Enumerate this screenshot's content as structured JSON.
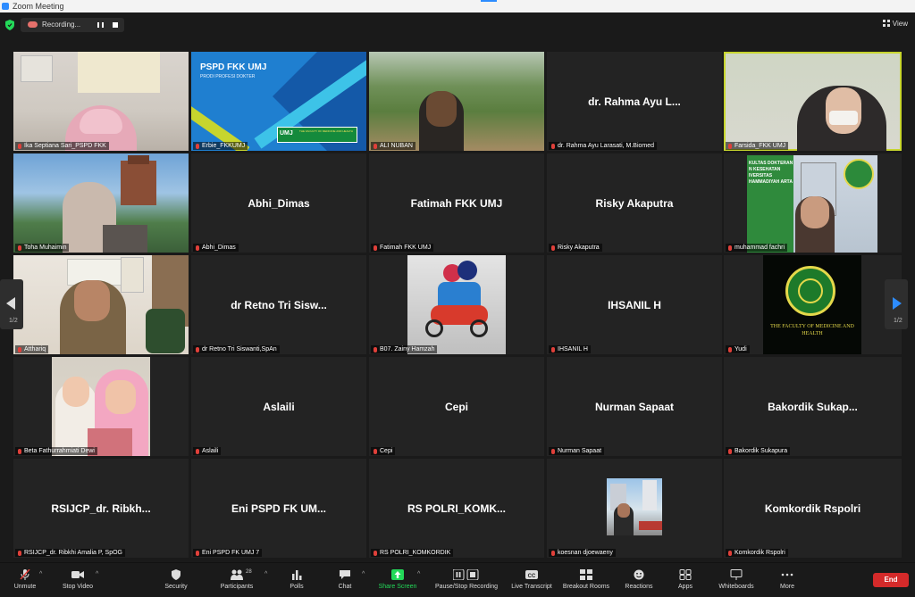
{
  "window": {
    "title": "Zoom Meeting"
  },
  "topbar": {
    "recording_label": "Recording...",
    "view_label": "View"
  },
  "pagination": {
    "left": "1/2",
    "right": "1/2"
  },
  "tiles": [
    {
      "label": "Ika Septiana Sari_PSPD FKK",
      "name": ""
    },
    {
      "label": "Erbie_FKKUMJ",
      "name": "",
      "slide_title": "PSPD FKK UMJ",
      "slide_sub": "PRODI PROFESI DOKTER",
      "slide_logo": "UMJ",
      "slide_badge": "THE FACULTY OF MEDICINE AND HEALTH"
    },
    {
      "label": "ALI NUBAN",
      "name": ""
    },
    {
      "label": "dr. Rahma Ayu Larasati, M.Biomed",
      "name": "dr. Rahma Ayu L..."
    },
    {
      "label": "Farsida_FKK UMJ",
      "name": ""
    },
    {
      "label": "Toha Muhaimin",
      "name": ""
    },
    {
      "label": "Abhi_Dimas",
      "name": "Abhi_Dimas"
    },
    {
      "label": "Fatimah FKK UMJ",
      "name": "Fatimah FKK UMJ"
    },
    {
      "label": "Risky Akaputra",
      "name": "Risky Akaputra"
    },
    {
      "label": "muhammad fachri",
      "name": "",
      "bg_text": "KULTAS DOKTERAN N KESEHATAN IVERSITAS HAMMADIYAH ARTA"
    },
    {
      "label": "Atthariq",
      "name": ""
    },
    {
      "label": "dr Retno Tri Siswanti,SpAn",
      "name": "dr Retno Tri Sisw..."
    },
    {
      "label": "B07. Zainy Hamzah",
      "name": ""
    },
    {
      "label": "IHSANIL H",
      "name": "IHSANIL H"
    },
    {
      "label": "Yudi",
      "name": "",
      "logo_text": "THE FACULTY OF MEDICINE AND HEALTH"
    },
    {
      "label": "Beta Fathurrahmiati Dewi",
      "name": ""
    },
    {
      "label": "Aslaili",
      "name": "Aslaili"
    },
    {
      "label": "Cepi",
      "name": "Cepi"
    },
    {
      "label": "Nurman Sapaat",
      "name": "Nurman Sapaat"
    },
    {
      "label": "Bakordik Sukapura",
      "name": "Bakordik  Sukap..."
    },
    {
      "label": "RSIJCP_dr. Ribkhi Amalia P, SpOG",
      "name": "RSIJCP_dr.  Ribkh..."
    },
    {
      "label": "Eni PSPD FK UMJ 7",
      "name": "Eni PSPD FK UM..."
    },
    {
      "label": "RS POLRI_KOMKORDIK",
      "name": "RS  POLRI_KOMK..."
    },
    {
      "label": "koesnan djoewaeny",
      "name": ""
    },
    {
      "label": "Komkordik Rspolri",
      "name": "Komkordik Rspolri"
    }
  ],
  "toolbar": {
    "unmute": "Unmute",
    "stop_video": "Stop Video",
    "security": "Security",
    "participants": "Participants",
    "participants_count": "28",
    "polls": "Polls",
    "chat": "Chat",
    "share_screen": "Share Screen",
    "pause_recording": "Pause/Stop Recording",
    "live_transcript": "Live Transcript",
    "breakout_rooms": "Breakout Rooms",
    "reactions": "Reactions",
    "apps": "Apps",
    "whiteboards": "Whiteboards",
    "more": "More",
    "end": "End"
  },
  "colors": {
    "active_speaker": "#c7d52e",
    "share_green": "#23d959",
    "end_red": "#d42a2a",
    "accent_blue": "#2d8cff"
  }
}
